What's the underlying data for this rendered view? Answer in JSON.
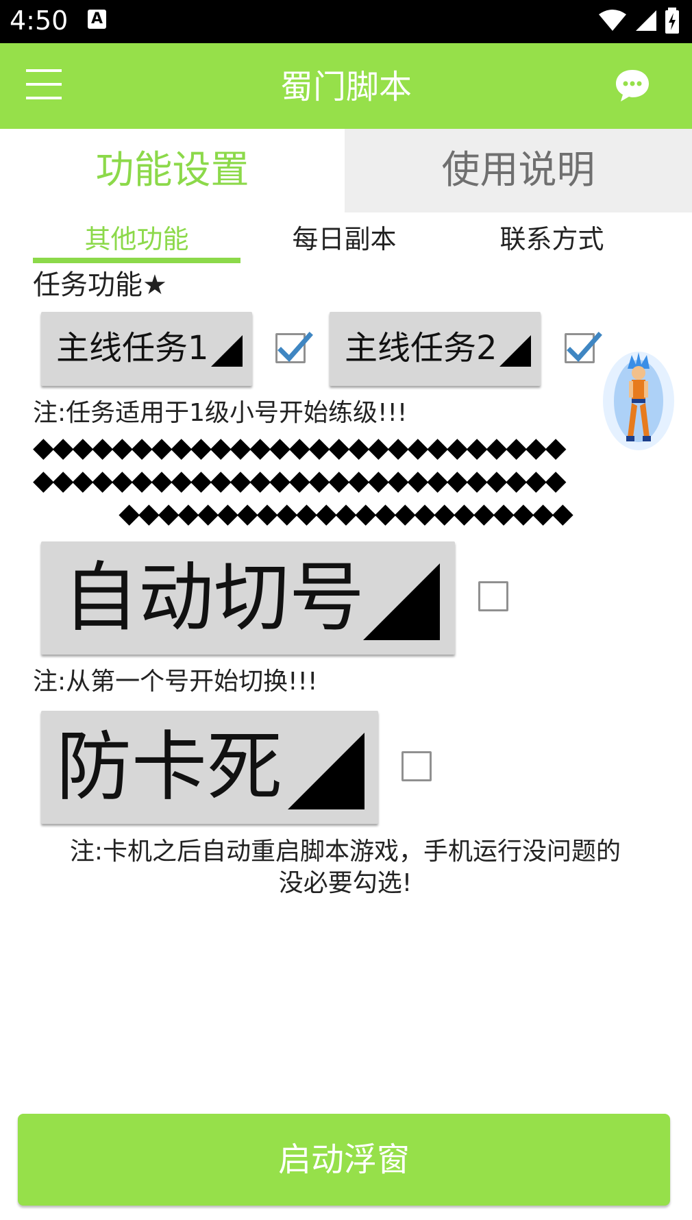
{
  "status_bar": {
    "time": "4:50",
    "notification_icon": "A"
  },
  "app_bar": {
    "title": "蜀门脚本",
    "menu_icon": "hamburger-menu-icon",
    "chat_icon": "chat-bubble-icon",
    "color": "#96e04a"
  },
  "top_tabs": [
    {
      "label": "功能设置",
      "active": true
    },
    {
      "label": "使用说明",
      "active": false
    }
  ],
  "sub_tabs": [
    {
      "label": "其他功能",
      "active": true
    },
    {
      "label": "每日副本",
      "active": false
    },
    {
      "label": "联系方式",
      "active": false
    }
  ],
  "main": {
    "section_title": "任务功能★",
    "spinner1": {
      "label": "主线任务1",
      "checked": true
    },
    "spinner2": {
      "label": "主线任务2",
      "checked": true
    },
    "note1": "注:任务适用于1级小号开始练级!!!",
    "diamond_rows": [
      "◆◆◆◆◆◆◆◆◆◆◆◆◆◆◆◆◆◆◆◆◆◆◆◆◆◆◆",
      "◆◆◆◆◆◆◆◆◆◆◆◆◆◆◆◆◆◆◆◆◆◆◆◆◆◆◆",
      "◆◆◆◆◆◆◆◆◆◆◆◆◆◆◆◆◆◆◆◆◆◆◆"
    ],
    "spinner3": {
      "label": "自动切号",
      "checked": false
    },
    "note2": "注:从第一个号开始切换!!!",
    "spinner4": {
      "label": "防卡死",
      "checked": false
    },
    "note3_line1": "注:卡机之后自动重启脚本游戏，手机运行没问题的",
    "note3_line2": "没必要勾选!"
  },
  "launch_button": {
    "label": "启动浮窗"
  },
  "colors": {
    "accent": "#8cd94a",
    "checkbox": "#3f86c2"
  }
}
